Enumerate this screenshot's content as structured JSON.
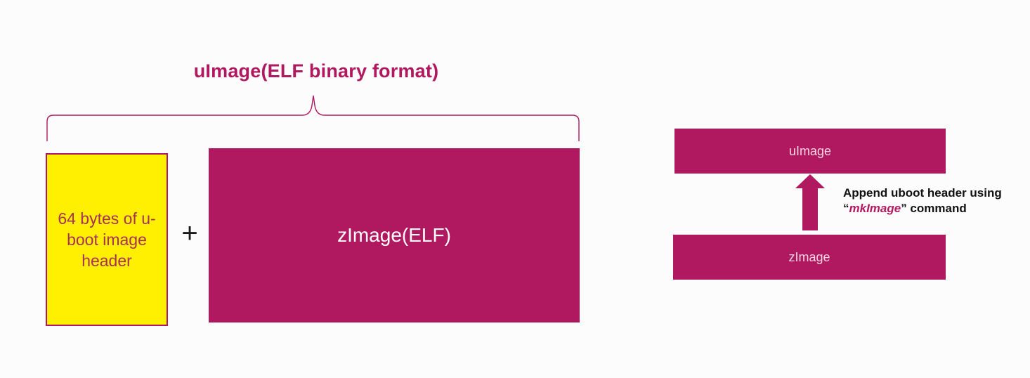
{
  "left_diagram": {
    "title": "uImage(ELF binary format)",
    "header_box_text": "64 bytes of u-boot image header",
    "plus_sign": "+",
    "zimage_box_text": "zImage(ELF)"
  },
  "right_diagram": {
    "top_bar_label": "uImage",
    "bottom_bar_label": "zImage",
    "note_line1": "Append uboot header using",
    "note_open_quote": "“",
    "note_command": "mkImage",
    "note_close_quote": "”",
    "note_suffix": " command"
  },
  "colors": {
    "magenta": "#b0195f",
    "yellow": "#ffef00",
    "header_text": "#a6325a",
    "background": "#fcfcfc"
  }
}
